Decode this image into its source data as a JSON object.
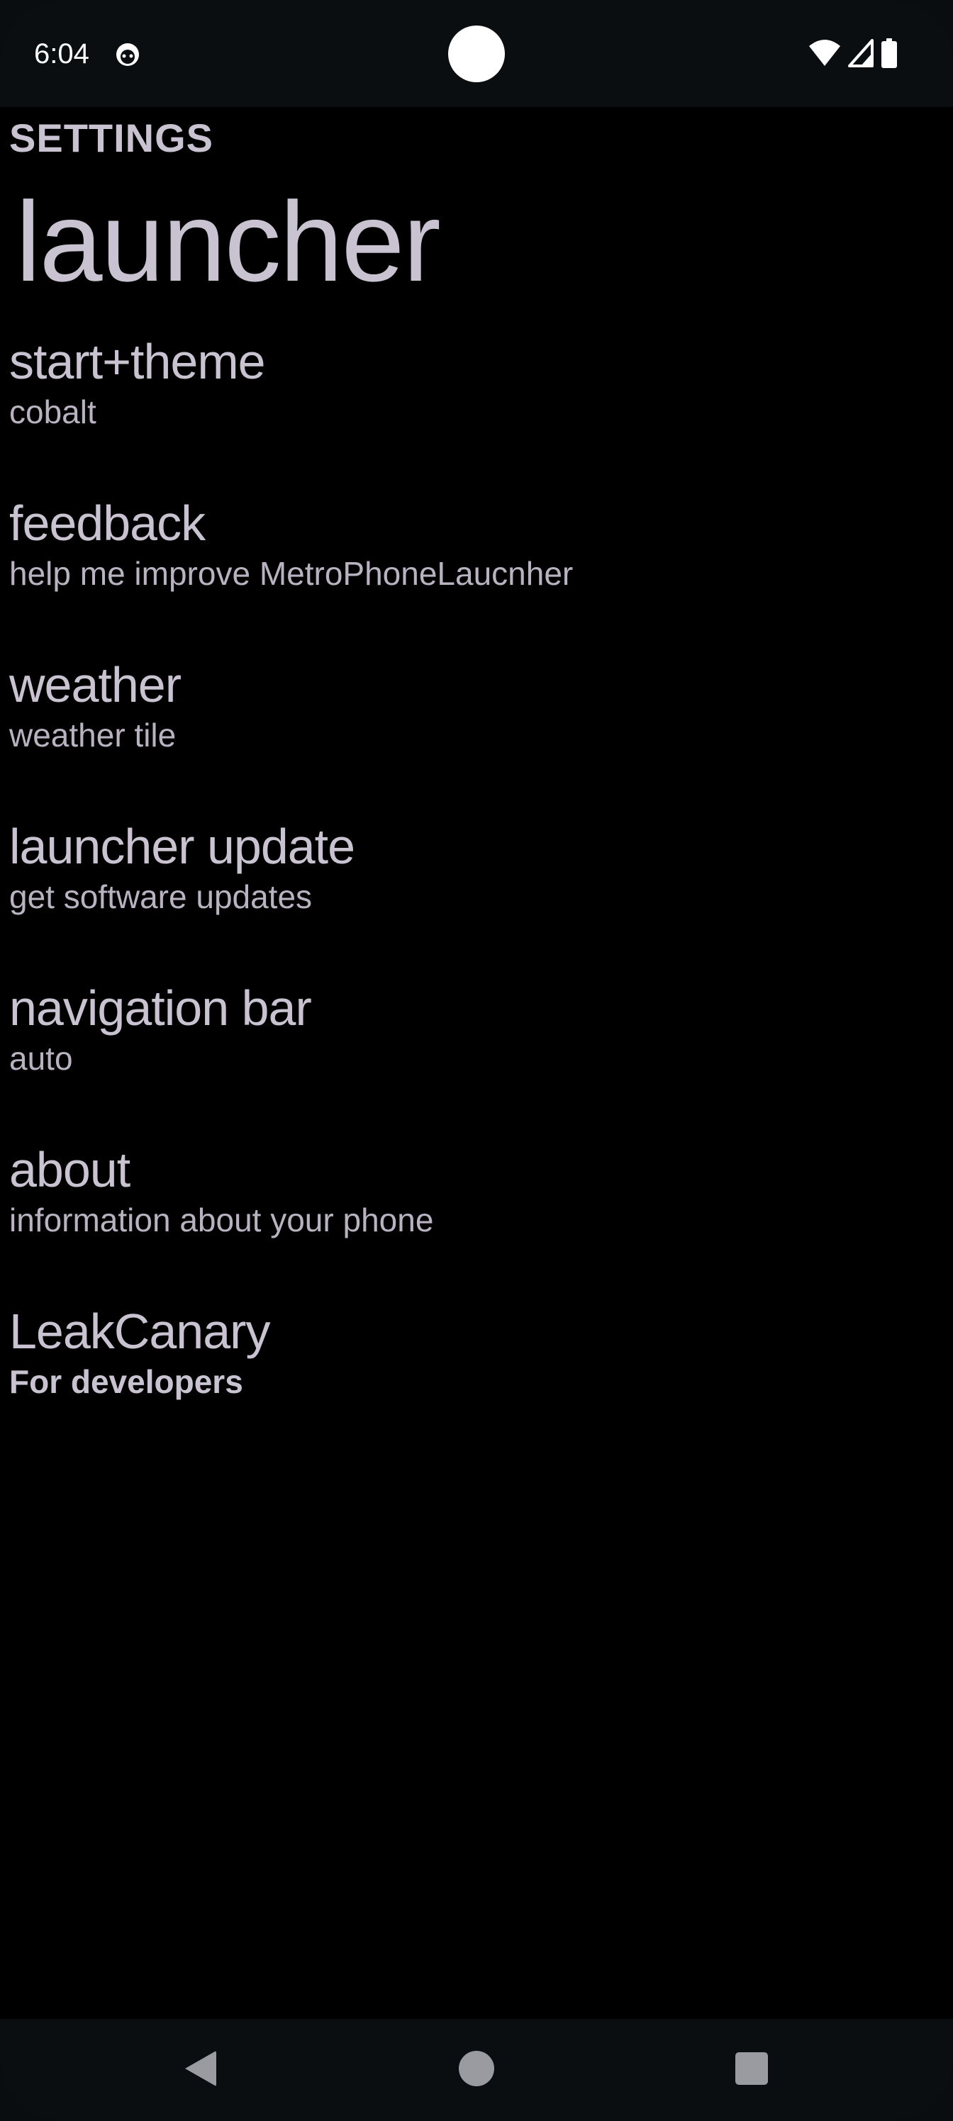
{
  "status_bar": {
    "time": "6:04",
    "app_icon": "notification-app-icon",
    "icons": [
      "wifi-icon",
      "cellular-signal-icon",
      "battery-icon"
    ]
  },
  "header": {
    "section": "SETTINGS",
    "title": "launcher"
  },
  "settings": [
    {
      "title": "start+theme",
      "subtitle": "cobalt"
    },
    {
      "title": "feedback",
      "subtitle": "help me improve MetroPhoneLaucnher"
    },
    {
      "title": "weather",
      "subtitle": "weather tile"
    },
    {
      "title": "launcher update",
      "subtitle": "get software updates"
    },
    {
      "title": "navigation bar",
      "subtitle": "auto"
    },
    {
      "title": "about",
      "subtitle": "information about your phone"
    },
    {
      "title": "LeakCanary",
      "subtitle": "For developers"
    }
  ],
  "nav_bar": {
    "icons": [
      "back-icon",
      "home-icon",
      "recents-icon"
    ]
  },
  "colors": {
    "background": "#000000",
    "bars": "#0b0e11",
    "text": "#c9c3d1",
    "subtext": "#b9b3c1"
  }
}
